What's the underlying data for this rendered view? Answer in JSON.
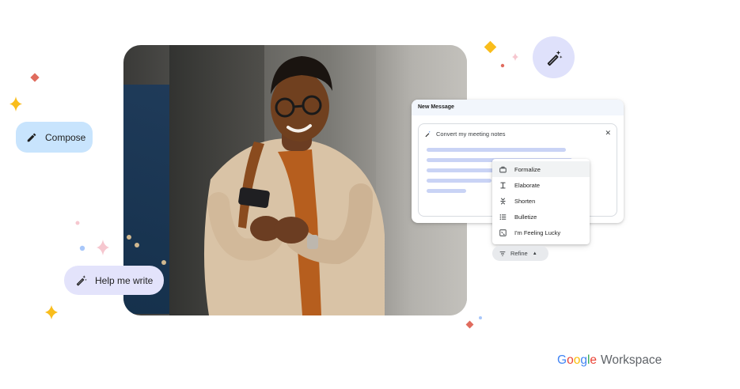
{
  "compose": {
    "label": "Compose",
    "icon": "pencil-icon"
  },
  "help_me_write": {
    "label": "Help me write",
    "icon": "magic-pen-icon"
  },
  "dialog": {
    "title": "New Message",
    "prompt": "Convert my meeting notes",
    "close_icon": "close-icon"
  },
  "menu": {
    "items": [
      {
        "label": "Formalize",
        "icon": "briefcase-icon"
      },
      {
        "label": "Elaborate",
        "icon": "expand-icon"
      },
      {
        "label": "Shorten",
        "icon": "collapse-icon"
      },
      {
        "label": "Bulletize",
        "icon": "list-icon"
      },
      {
        "label": "I'm Feeling Lucky",
        "icon": "dice-icon"
      }
    ]
  },
  "refine": {
    "label": "Refine",
    "icon": "filter-icon"
  },
  "branding": {
    "google_letters": [
      "G",
      "o",
      "o",
      "g",
      "l",
      "e"
    ],
    "google_colors": [
      "#4285F4",
      "#EA4335",
      "#FBBC05",
      "#4285F4",
      "#34A853",
      "#EA4335"
    ],
    "product": "Workspace"
  },
  "colors": {
    "compose_chip": "#c8e4fd",
    "help_chip": "#e3e3fb",
    "sparkle_yellow": "#fbbc04",
    "sparkle_red": "#ea4335",
    "sparkle_pink": "#f6c7cf",
    "sparkle_blue": "#a8c7fa"
  }
}
